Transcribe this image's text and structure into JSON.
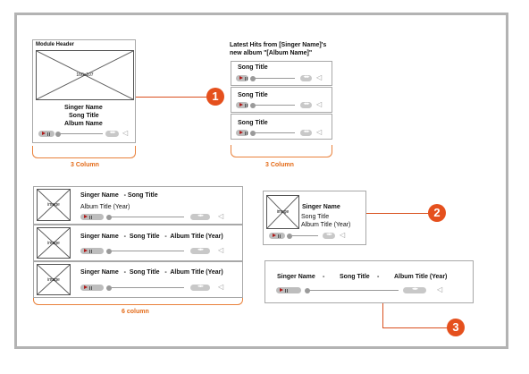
{
  "colors": {
    "accent": "#e5501d",
    "border": "#b3b3b3"
  },
  "module1": {
    "header": "Module Header",
    "image_size": "160x107",
    "singer": "Singer Name",
    "song": "Song Title",
    "album": "Album Name",
    "caption": "3 Column"
  },
  "latest": {
    "title_line1": "Latest Hits from [Singer Name]'s",
    "title_line2": "new album \"[Album Name]\"",
    "songs": [
      "Song Title",
      "Song Title",
      "Song Title"
    ],
    "caption": "3 Column"
  },
  "rows": {
    "image_label": "image",
    "row1_line1": "Singer Name   - Song Title",
    "row1_line2": "Album Title (Year)",
    "row2": "Singer Name   -  Song Title   -  Album Title (Year)",
    "row3": "Singer Name   -  Song Title   -  Album Title (Year)",
    "caption": "6 column"
  },
  "card2": {
    "image_label": "image",
    "singer": "Singer Name",
    "song": "Song Title",
    "album": "Album Title (Year)"
  },
  "wide": {
    "singer": "Singer Name",
    "dash1": "-",
    "song": "Song Title",
    "dash2": "-",
    "album": "Album Title (Year)"
  },
  "callouts": [
    "1",
    "2",
    "3"
  ]
}
